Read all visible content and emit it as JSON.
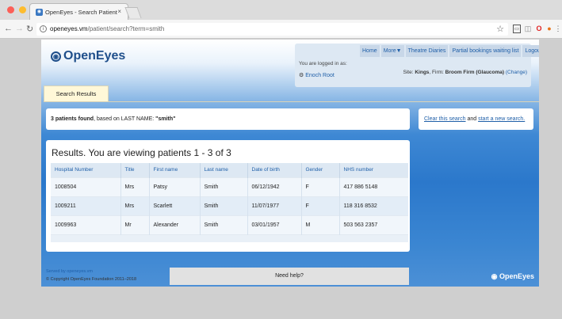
{
  "browser": {
    "tab_title": "OpenEyes - Search Patient",
    "tab_close": "×",
    "url_host": "openeyes.vm",
    "url_path": "/patient/search?term=smith"
  },
  "header": {
    "logo": "OpenEyes",
    "nav": [
      "Home",
      "More▼",
      "Theatre Diaries",
      "Partial bookings waiting list",
      "Logout"
    ],
    "logged_in_label": "You are logged in as:",
    "username": "Enoch Root",
    "site_label": "Site:",
    "site": "Kings",
    "firm_label": "Firm:",
    "firm": "Broom Firm (Glaucoma)",
    "change": "(Change)"
  },
  "tab": {
    "label": "Search Results"
  },
  "summary": {
    "count_text": "3 patients found",
    "basis": ", based on LAST NAME: ",
    "term": "\"smith\""
  },
  "actions": {
    "clear": "Clear this search",
    "and": " and ",
    "new_search": "start a new search."
  },
  "results": {
    "heading": "Results. You are viewing patients 1 - 3 of 3",
    "columns": [
      "Hospital Number",
      "Title",
      "First name",
      "Last name",
      "Date of birth",
      "Gender",
      "NHS number"
    ],
    "rows": [
      [
        "1008504",
        "Mrs",
        "Patsy",
        "Smith",
        "06/12/1942",
        "F",
        "417 886 5148"
      ],
      [
        "1009211",
        "Mrs",
        "Scarlett",
        "Smith",
        "11/07/1977",
        "F",
        "118 316 8532"
      ],
      [
        "1009963",
        "Mr",
        "Alexander",
        "Smith",
        "03/01/1957",
        "M",
        "503 563 2357"
      ]
    ]
  },
  "footer": {
    "served": "Served by openeyes.vm",
    "copyright": "© Copyright OpenEyes Foundation 2011–2018",
    "help": "Need help?",
    "logo": "OpenEyes"
  }
}
